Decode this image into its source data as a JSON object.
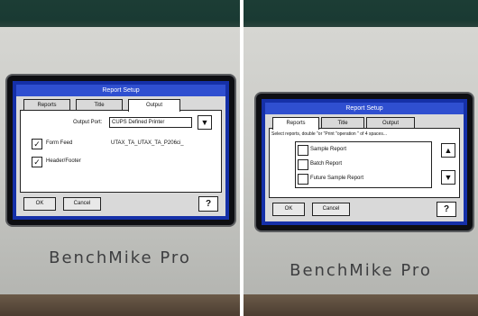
{
  "left_device": {
    "brand": "BenchMike Pro",
    "dialog": {
      "title": "Report Setup",
      "tabs": [
        "Reports",
        "Title",
        "Output"
      ],
      "active_tab": "Output",
      "output_port_label": "Output Port:",
      "output_port_value": "CUPS Defined Printer",
      "form_feed_label": "Form Feed",
      "form_feed_checked": "✓",
      "header_footer_label": "Header/Footer",
      "header_footer_checked": "✓",
      "filename_value": "UTAX_TA_UTAX_TA_P206ci_",
      "ok_label": "OK",
      "cancel_label": "Cancel",
      "help_label": "?"
    }
  },
  "right_device": {
    "brand": "BenchMike Pro",
    "dialog": {
      "title": "Report Setup",
      "tabs": [
        "Reports",
        "Title",
        "Output"
      ],
      "active_tab": "Reports",
      "instruction": "Select reports, double \"or \"Print \"operation \" of 4 spaces...",
      "report_items": [
        "Sample Report",
        "Batch Report",
        "Future Sample Report"
      ],
      "ok_label": "OK",
      "cancel_label": "Cancel",
      "help_label": "?"
    }
  }
}
